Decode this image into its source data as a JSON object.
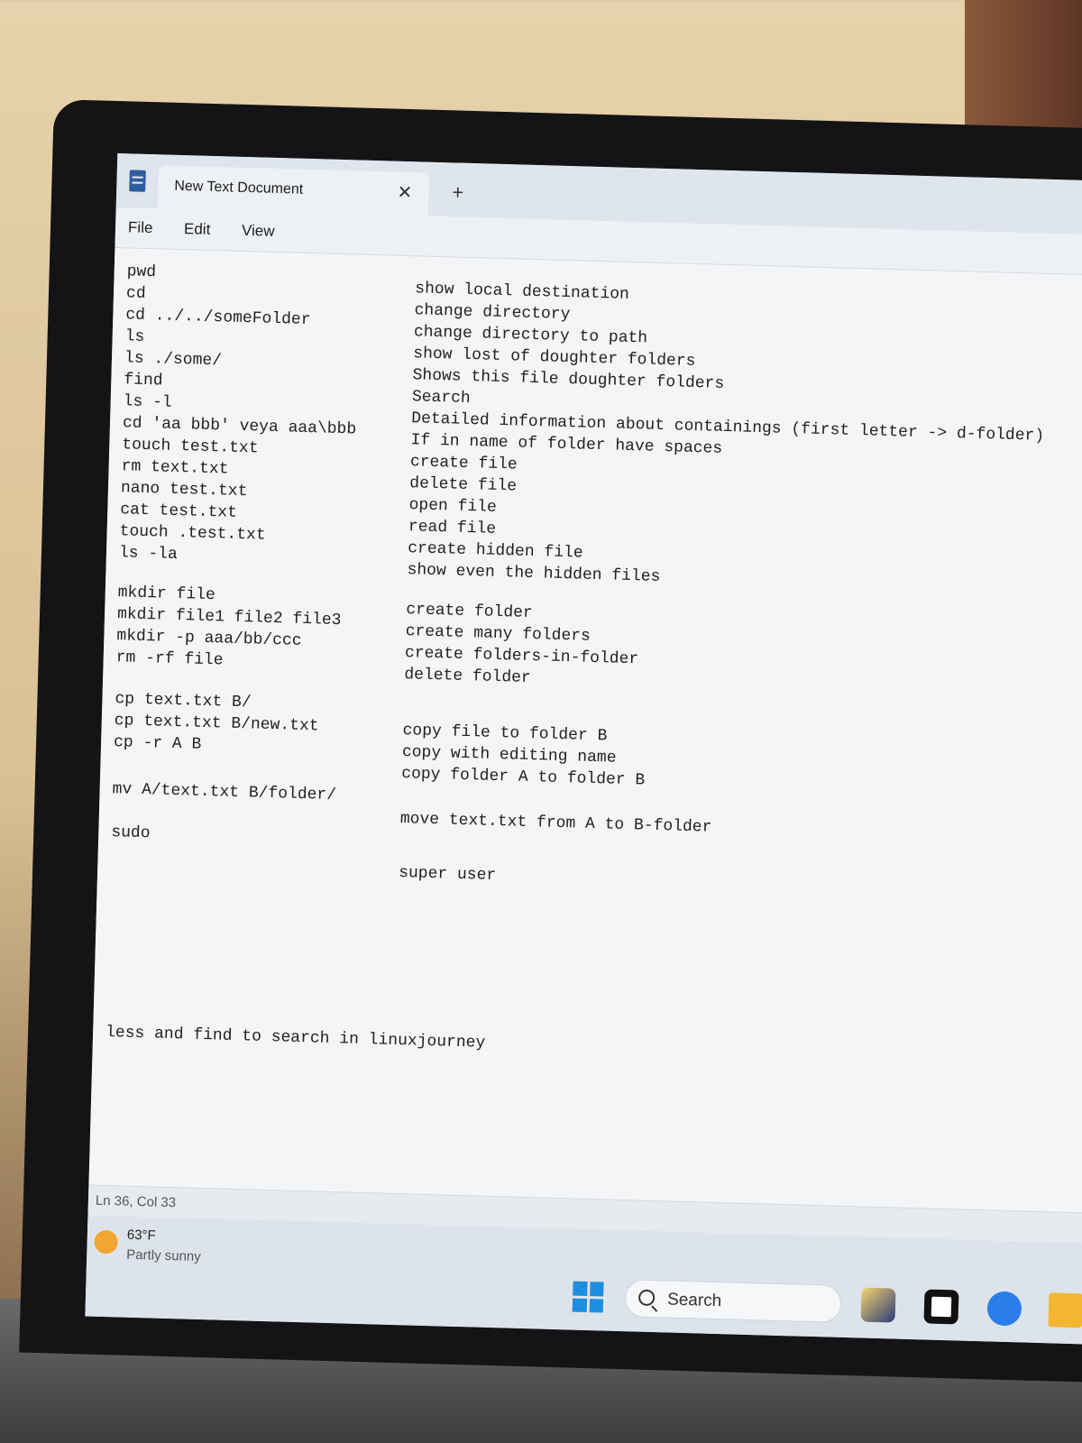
{
  "window": {
    "tab_title": "New Text Document",
    "close_glyph": "✕",
    "new_tab_glyph": "+"
  },
  "menu": {
    "file": "File",
    "edit": "Edit",
    "view": "View"
  },
  "commands": [
    {
      "cmd": "pwd",
      "desc": "show local destination"
    },
    {
      "cmd": "cd",
      "desc": "change directory"
    },
    {
      "cmd": "cd ../../someFolder",
      "desc": "change directory to path"
    },
    {
      "cmd": "ls",
      "desc": "show lost of doughter folders"
    },
    {
      "cmd": "ls ./some/",
      "desc": "Shows this file doughter folders"
    },
    {
      "cmd": "find",
      "desc": "Search"
    },
    {
      "cmd": "ls -l",
      "desc": "Detailed information about containings (first letter -> d-folder)"
    },
    {
      "cmd": "cd 'aa bbb' veya aaa\\bbb",
      "desc": "If in name of folder have spaces"
    },
    {
      "cmd": "touch test.txt",
      "desc": "create file"
    },
    {
      "cmd": "rm text.txt",
      "desc": "delete file"
    },
    {
      "cmd": "nano test.txt",
      "desc": "open file"
    },
    {
      "cmd": "cat test.txt",
      "desc": "read file"
    },
    {
      "cmd": "touch .test.txt",
      "desc": "create hidden file"
    },
    {
      "cmd": "ls -la",
      "desc": "show even the hidden files"
    },
    {
      "cmd": "mkdir file",
      "desc": "create folder"
    },
    {
      "cmd": "mkdir file1 file2 file3",
      "desc": "create many folders"
    },
    {
      "cmd": "mkdir -p aaa/bb/ccc",
      "desc": "create folders-in-folder"
    },
    {
      "cmd": "rm -rf file",
      "desc": "delete folder"
    },
    {
      "cmd": "cp text.txt B/",
      "desc": "copy file to folder B"
    },
    {
      "cmd": "cp text.txt B/new.txt",
      "desc": "copy with editing name"
    },
    {
      "cmd": "cp -r A B",
      "desc": "copy folder A to folder B"
    },
    {
      "cmd": "mv A/text.txt B/folder/",
      "desc": "move text.txt from A to B-folder"
    },
    {
      "cmd": "sudo",
      "desc": "super user"
    }
  ],
  "footer_note": "less and find to search in linuxjourney",
  "status": {
    "cursor": "Ln 36, Col 33"
  },
  "weather": {
    "temp": "63°F",
    "desc": "Partly sunny",
    "icon": "weather-partly-sunny-icon"
  },
  "taskbar": {
    "search_label": "Search"
  }
}
